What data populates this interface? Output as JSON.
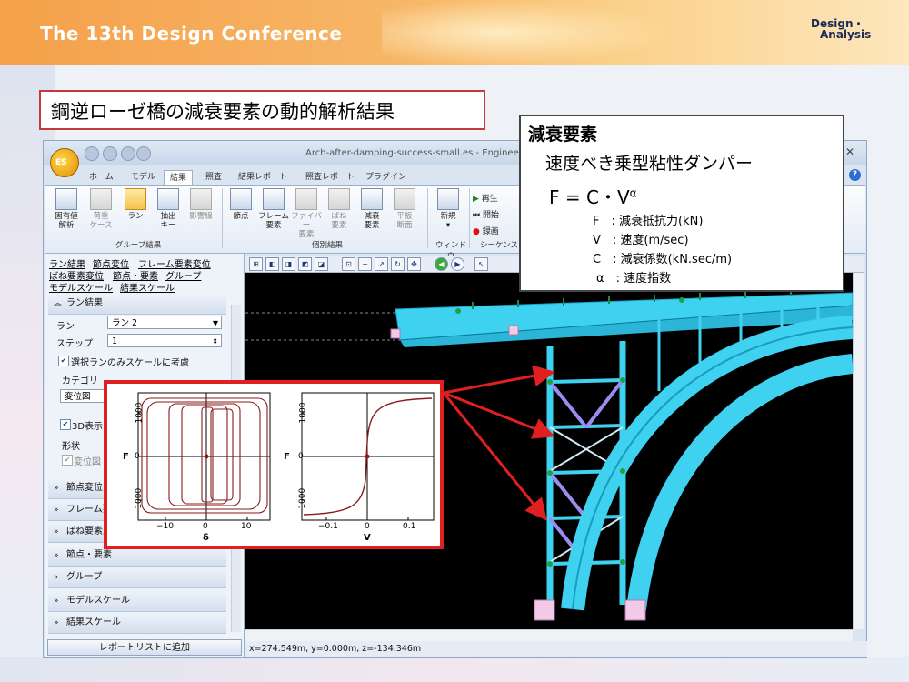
{
  "slide": {
    "header_title": "The 13th Design Conference",
    "brand_line1": "Design・",
    "brand_line2": "Analysis",
    "heading": "鋼逆ローゼ橋の減衰要素の動的解析結果"
  },
  "window": {
    "title": "Arch-after-damping-success-small.es - Engineer",
    "app_logo": "ES",
    "close_glyph": "✕",
    "help_glyph": "?"
  },
  "ribbon": {
    "tabs": [
      "ホーム",
      "モデル",
      "結果",
      "照査",
      "結果レポート",
      "照査レポート",
      "プラグイン"
    ],
    "active_tab_index": 2,
    "groups": {
      "group_result": "グループ結果",
      "individual_result": "個別結果",
      "window": "ウィンドウ",
      "sequence": "シーケンス"
    },
    "buttons": {
      "eigen": [
        "固有値",
        "解析"
      ],
      "load_case": [
        "荷重",
        "ケース"
      ],
      "run": [
        "ラン",
        ""
      ],
      "extract_key": [
        "抽出",
        "キー"
      ],
      "influence_line": [
        "影響線",
        ""
      ],
      "node": [
        "節点",
        ""
      ],
      "frame": [
        "フレーム",
        "要素"
      ],
      "fiber": [
        "ファイバー",
        "要素"
      ],
      "spring": [
        "ばね",
        "要素"
      ],
      "damping": [
        "減衰",
        "要素"
      ],
      "plane_section": [
        "平板",
        "断面"
      ],
      "new": [
        "新規",
        "▾"
      ]
    },
    "play": {
      "play": "再生",
      "start": "開始",
      "record": "録画"
    }
  },
  "left_panel": {
    "links": [
      "ラン結果",
      "節点変位",
      "フレーム要素変位",
      "ばね要素変位",
      "節点・要素",
      "グループ",
      "モデルスケール",
      "結果スケール"
    ],
    "run_section": {
      "header": "ラン結果",
      "run_label": "ラン",
      "run_value": "ラン 2",
      "step_label": "ステップ",
      "step_value": "1",
      "scale_checkbox": "選択ランのみスケールに考慮",
      "category_label": "カテゴリ",
      "category_value": "変位図",
      "display_3d": "3D表示",
      "shape_label": "形状",
      "disp_checkbox": "変位図"
    },
    "sections": [
      "節点変位",
      "フレーム要素",
      "ばね要素変",
      "節点・要素",
      "グループ",
      "モデルスケール",
      "結果スケール"
    ],
    "add_report_button": "レポートリストに追加"
  },
  "viewport": {
    "status": "x=274.549m, y=0.000m, z=-134.346m"
  },
  "callout": {
    "title": "減衰要素",
    "subtitle": "速度べき乗型粘性ダンパー",
    "formula_main": "F = C・V",
    "formula_exp": "α",
    "definitions": [
      "F　: 減衰抵抗力(kN)",
      "V　: 速度(m/sec)",
      "C　: 減衰係数(kN.sec/m)",
      "α　: 速度指数"
    ]
  },
  "graphs": {
    "left": {
      "xlabel": "δ",
      "ylabel": "F",
      "xticks": [
        "−10",
        "0",
        "10"
      ],
      "yticks": [
        "1000",
        "0",
        "−1000"
      ]
    },
    "right": {
      "xlabel": "V",
      "ylabel": "F",
      "xticks": [
        "−0.1",
        "0",
        "0.1"
      ],
      "yticks": [
        "1000",
        "0",
        "−1000"
      ]
    }
  },
  "colors": {
    "accent_red": "#e02020",
    "bridge": "#3fd2f0",
    "curve": "#8b1a1a"
  }
}
